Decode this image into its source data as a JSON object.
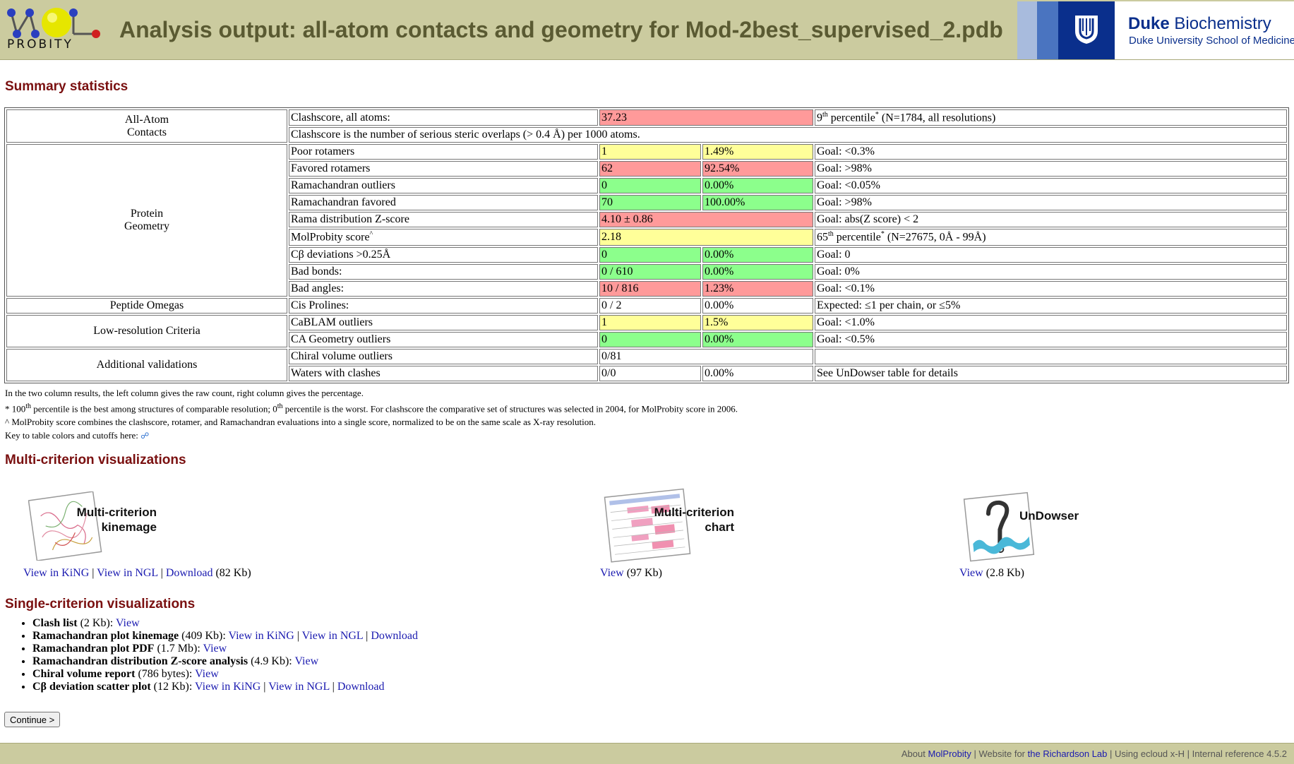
{
  "header": {
    "title": "Analysis output: all-atom contacts and geometry for Mod-2best_supervised_2.pdb",
    "logo_word": "PROBITY",
    "duke_title_bold": "Duke",
    "duke_title_rest": " Biochemistry",
    "duke_subtitle": "Duke University School of Medicine"
  },
  "summary": {
    "heading": "Summary statistics",
    "rows": {
      "clashscore": {
        "category": "All-Atom Contacts",
        "label": "Clashscore, all atoms:",
        "value": "37.23",
        "goal_pre": "9",
        "goal_sup": "th",
        "goal_mid": " percentile",
        "goal_star": "*",
        "goal_post": " (N=1784, all resolutions)"
      },
      "clash_note": "Clashscore is the number of serious steric overlaps (> 0.4 Å) per 1000 atoms.",
      "poor_rot": {
        "label": "Poor rotamers",
        "v1": "1",
        "v2": "1.49%",
        "goal": "Goal: <0.3%"
      },
      "fav_rot": {
        "label": "Favored rotamers",
        "v1": "62",
        "v2": "92.54%",
        "goal": "Goal: >98%"
      },
      "rama_out": {
        "label": "Ramachandran outliers",
        "v1": "0",
        "v2": "0.00%",
        "goal": "Goal: <0.05%"
      },
      "rama_fav": {
        "label": "Ramachandran favored",
        "v1": "70",
        "v2": "100.00%",
        "goal": "Goal: >98%"
      },
      "rama_z": {
        "label": "Rama distribution Z-score",
        "v1": "4.10 ± 0.86",
        "goal": "Goal: abs(Z score) < 2"
      },
      "molprobity": {
        "label": "MolProbity score",
        "label_sup": "^",
        "v1": "2.18",
        "goal_pre": "65",
        "goal_sup": "th",
        "goal_mid": " percentile",
        "goal_star": "*",
        "goal_post": " (N=27675, 0Å - 99Å)"
      },
      "cb_dev": {
        "label": "Cβ deviations >0.25Å",
        "v1": "0",
        "v2": "0.00%",
        "goal": "Goal: 0"
      },
      "bad_bonds": {
        "label": "Bad bonds:",
        "v1": "0 / 610",
        "v2": "0.00%",
        "goal": "Goal: 0%"
      },
      "bad_angles": {
        "label": "Bad angles:",
        "v1": "10 / 816",
        "v2": "1.23%",
        "goal": "Goal: <0.1%"
      },
      "cis_pro": {
        "category": "Peptide Omegas",
        "label": "Cis Prolines:",
        "v1": "0 / 2",
        "v2": "0.00%",
        "goal": "Expected: ≤1 per chain, or ≤5%"
      },
      "cablam": {
        "category": "Low-resolution Criteria",
        "label": "CaBLAM outliers",
        "v1": "1",
        "v2": "1.5%",
        "goal": "Goal: <1.0%"
      },
      "ca_geom": {
        "label": "CA Geometry outliers",
        "v1": "0",
        "v2": "0.00%",
        "goal": "Goal: <0.5%"
      },
      "chiral": {
        "category": "Additional validations",
        "label": "Chiral volume outliers",
        "v1": "0/81",
        "goal": ""
      },
      "waters": {
        "label": "Waters with clashes",
        "v1": "0/0",
        "v2": "0.00%",
        "goal": "See UnDowser table for details"
      }
    },
    "categories": {
      "contacts_l1": "All-Atom",
      "contacts_l2": "Contacts",
      "geometry_l1": "Protein",
      "geometry_l2": "Geometry"
    },
    "notes": {
      "n1": "In the two column results, the left column gives the raw count, right column gives the percentage.",
      "n2_a": "* 100",
      "n2_b": " percentile is the best among structures of comparable resolution; 0",
      "n2_c": " percentile is the worst. For clashscore the comparative set of structures was selected in 2004, for MolProbity score in 2006.",
      "n2_sup": "th",
      "n3": "^ MolProbity score combines the clashscore, rotamer, and Ramachandran evaluations into a single score, normalized to be on the same scale as X-ray resolution.",
      "n4": "Key to table colors and cutoffs here: "
    }
  },
  "colors": {
    "red": "#ff9a9a",
    "yellow": "#ffff99",
    "green": "#8cff8c",
    "header_bg": "#cbcb9f",
    "heading": "#7a1010",
    "link": "#1a1ab0"
  },
  "multi": {
    "heading": "Multi-criterion visualizations",
    "kinemage": {
      "label_l1": "Multi-criterion",
      "label_l2": "kinemage",
      "link1": "View in KiNG",
      "sep": " | ",
      "link2": "View in NGL",
      "link3": "Download",
      "size": " (82 Kb)"
    },
    "chart": {
      "label_l1": "Multi-criterion",
      "label_l2": "chart",
      "link1": "View",
      "size": " (97 Kb)"
    },
    "undowser": {
      "label": "UnDowser",
      "link1": "View",
      "size": " (2.8 Kb)"
    }
  },
  "single": {
    "heading": "Single-criterion visualizations",
    "items": [
      {
        "name": "Clash list",
        "size": " (2 Kb): ",
        "links": [
          "View"
        ]
      },
      {
        "name": "Ramachandran plot kinemage",
        "size": " (409 Kb): ",
        "links": [
          "View in KiNG",
          "View in NGL",
          "Download"
        ]
      },
      {
        "name": "Ramachandran plot PDF",
        "size": " (1.7 Mb): ",
        "links": [
          "View"
        ]
      },
      {
        "name": "Ramachandran distribution Z-score analysis",
        "size": " (4.9 Kb): ",
        "links": [
          "View"
        ]
      },
      {
        "name": "Chiral volume report",
        "size": " (786 bytes): ",
        "links": [
          "View"
        ]
      },
      {
        "name": "Cβ deviation scatter plot",
        "size": " (12 Kb): ",
        "links": [
          "View in KiNG",
          "View in NGL",
          "Download"
        ]
      }
    ]
  },
  "continue_label": "Continue >",
  "footer": {
    "about": "About ",
    "molprobity": "MolProbity",
    "website": " | Website for ",
    "lab": "the Richardson Lab",
    "rest": " | Using ecloud x-H | Internal reference 4.5.2"
  }
}
